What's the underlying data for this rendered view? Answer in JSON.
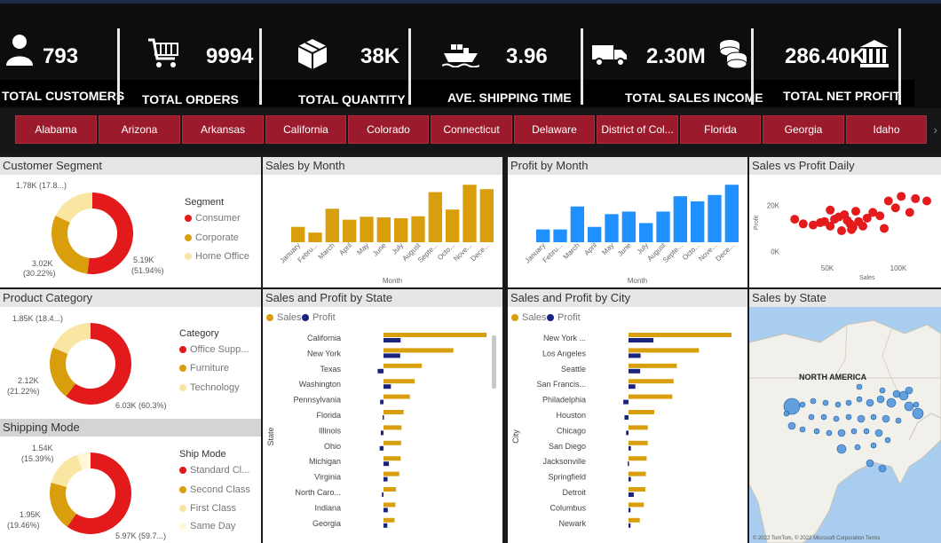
{
  "kpis": [
    {
      "value": "793",
      "label": "TOTAL CUSTOMERS",
      "icon": "user-icon"
    },
    {
      "value": "9994",
      "label": "TOTAL ORDERS",
      "icon": "cart-icon"
    },
    {
      "value": "38K",
      "label": "TOTAL QUANTITY",
      "icon": "boxes-icon"
    },
    {
      "value": "3.96",
      "label": "AVE. SHIPPING TIME",
      "icon": "ship-icon"
    },
    {
      "value": "2.30M",
      "label": "TOTAL SALES INCOME",
      "icon": "truck-icon"
    },
    {
      "value": "286.40K",
      "label": "TOTAL NET PROFIT",
      "icon": "bank-icon"
    }
  ],
  "states": [
    "Alabama",
    "Arizona",
    "Arkansas",
    "California",
    "Colorado",
    "Connecticut",
    "Delaware",
    "District of Col...",
    "Florida",
    "Georgia",
    "Idaho"
  ],
  "colors": {
    "red": "#e31a1c",
    "gold": "#d99e0b",
    "light": "#f9e6a3",
    "blue": "#1e90ff",
    "navy": "#1a237e",
    "scatter": "#e41a1c",
    "state_btn": "#9b1b2c"
  },
  "customer_segment": {
    "title": "Customer Segment",
    "legend_title": "Segment",
    "items": [
      "Consumer",
      "Corporate",
      "Home Office"
    ],
    "labels": {
      "top": "1.78K (17.8...)",
      "left1": "3.02K",
      "left2": "(30.22%)",
      "right1": "5.19K",
      "right2": "(51.94%)"
    }
  },
  "product_category": {
    "title": "Product Category",
    "legend_title": "Category",
    "items": [
      "Office Supp...",
      "Furniture",
      "Technology"
    ],
    "labels": {
      "top": "1.85K (18.4...)",
      "left1": "2.12K",
      "left2": "(21.22%)",
      "right1": "6.03K (60.3%)"
    }
  },
  "shipping_mode": {
    "title": "Shipping Mode",
    "legend_title": "Ship Mode",
    "items": [
      "Standard Cl...",
      "Second Class",
      "First Class",
      "Same Day"
    ],
    "labels": {
      "top1": "1.54K",
      "top2": "(15.39%)",
      "left1": "1.95K",
      "left2": "(19.46%)",
      "right1": "5.97K (59.7...)"
    }
  },
  "sales_by_month": {
    "title": "Sales by Month",
    "xlabel": "Month"
  },
  "profit_by_month": {
    "title": "Profit by Month",
    "xlabel": "Month"
  },
  "sales_vs_profit": {
    "title": "Sales vs Profit Daily",
    "xlabel": "Sales",
    "ylabel": "Profit"
  },
  "sales_profit_state": {
    "title": "Sales and Profit by State",
    "axis": "State",
    "legend_sales": "Sales",
    "legend_profit": "Profit"
  },
  "sales_profit_city": {
    "title": "Sales and Profit by City",
    "axis": "City",
    "legend_sales": "Sales",
    "legend_profit": "Profit"
  },
  "sales_by_state": {
    "title": "Sales by State",
    "map_label": "NORTH AMERICA",
    "credit": "© 2022 TomTom, © 2022 Microsoft Corporation Terms"
  },
  "chart_data": [
    {
      "type": "donut",
      "title": "Customer Segment",
      "categories": [
        "Consumer",
        "Corporate",
        "Home Office"
      ],
      "values": [
        5190,
        3020,
        1780
      ],
      "percent": [
        51.94,
        30.22,
        17.8
      ]
    },
    {
      "type": "donut",
      "title": "Product Category",
      "categories": [
        "Office Supplies",
        "Furniture",
        "Technology"
      ],
      "values": [
        6030,
        2120,
        1850
      ],
      "percent": [
        60.3,
        21.22,
        18.4
      ]
    },
    {
      "type": "donut",
      "title": "Shipping Mode",
      "categories": [
        "Standard Class",
        "Second Class",
        "First Class",
        "Same Day"
      ],
      "values": [
        5970,
        1950,
        1540,
        540
      ],
      "percent": [
        59.7,
        19.46,
        15.39,
        5.4
      ]
    },
    {
      "type": "bar",
      "title": "Sales by Month",
      "xlabel": "Month",
      "categories": [
        "January",
        "Febru...",
        "March",
        "April",
        "May",
        "June",
        "July",
        "August",
        "Septe...",
        "Octo...",
        "Nove...",
        "Dece..."
      ],
      "values": [
        94,
        59,
        205,
        138,
        156,
        152,
        147,
        159,
        307,
        200,
        352,
        325
      ]
    },
    {
      "type": "bar",
      "title": "Profit by Month",
      "xlabel": "Month",
      "categories": [
        "January",
        "Febru...",
        "March",
        "April",
        "May",
        "June",
        "July",
        "August",
        "Septe...",
        "Octo...",
        "Nove...",
        "Dece..."
      ],
      "values": [
        10,
        10,
        28,
        12,
        22,
        24,
        15,
        24,
        36,
        32,
        37,
        45
      ]
    },
    {
      "type": "scatter",
      "title": "Sales vs Profit Daily",
      "xlabel": "Sales",
      "ylabel": "Profit",
      "x_ticks": [
        "50K",
        "100K"
      ],
      "y_ticks": [
        "0K",
        "20K"
      ],
      "xlim": [
        20000,
        125000
      ],
      "ylim": [
        -3000,
        28000
      ],
      "points": [
        [
          27000,
          14000
        ],
        [
          33000,
          12000
        ],
        [
          40000,
          11500
        ],
        [
          45000,
          12500
        ],
        [
          48000,
          13000
        ],
        [
          52000,
          11000
        ],
        [
          55000,
          14000
        ],
        [
          58000,
          15000
        ],
        [
          60000,
          9000
        ],
        [
          62000,
          16000
        ],
        [
          64000,
          13500
        ],
        [
          66000,
          12000
        ],
        [
          68000,
          10500
        ],
        [
          70000,
          17500
        ],
        [
          72000,
          13000
        ],
        [
          75000,
          11000
        ],
        [
          78000,
          14500
        ],
        [
          82000,
          17000
        ],
        [
          87000,
          15500
        ],
        [
          90000,
          10000
        ],
        [
          93000,
          22000
        ],
        [
          98000,
          19000
        ],
        [
          102000,
          24000
        ],
        [
          108000,
          17000
        ],
        [
          112000,
          23000
        ],
        [
          120000,
          22000
        ],
        [
          52000,
          18000
        ],
        [
          67000,
          9500
        ]
      ]
    },
    {
      "type": "bar",
      "orientation": "horizontal",
      "title": "Sales and Profit by State",
      "categories": [
        "California",
        "New York",
        "Texas",
        "Washington",
        "Pennsylvania",
        "Florida",
        "Illinois",
        "Ohio",
        "Michigan",
        "Virginia",
        "North Caro...",
        "Indiana",
        "Georgia"
      ],
      "series": [
        {
          "name": "Sales",
          "values": [
            457,
            310,
            170,
            138,
            117,
            89,
            80,
            78,
            76,
            70,
            55,
            53,
            49
          ]
        },
        {
          "name": "Profit",
          "values": [
            76,
            74,
            -26,
            33,
            -15,
            -4,
            -12,
            -17,
            24,
            18,
            -7,
            19,
            17
          ]
        }
      ]
    },
    {
      "type": "bar",
      "orientation": "horizontal",
      "title": "Sales and Profit by City",
      "categories": [
        "New York ...",
        "Los Angeles",
        "Seattle",
        "San Francis...",
        "Philadelphia",
        "Houston",
        "Chicago",
        "San Diego",
        "Jacksonville",
        "Springfield",
        "Detroit",
        "Columbus",
        "Newark"
      ],
      "series": [
        {
          "name": "Sales",
          "values": [
            256,
            175,
            120,
            112,
            109,
            64,
            48,
            48,
            45,
            43,
            42,
            38,
            28
          ]
        },
        {
          "name": "Profit",
          "values": [
            62,
            30,
            29,
            17,
            -13,
            -10,
            -6,
            6,
            -2,
            6,
            13,
            5,
            5
          ]
        }
      ]
    }
  ]
}
